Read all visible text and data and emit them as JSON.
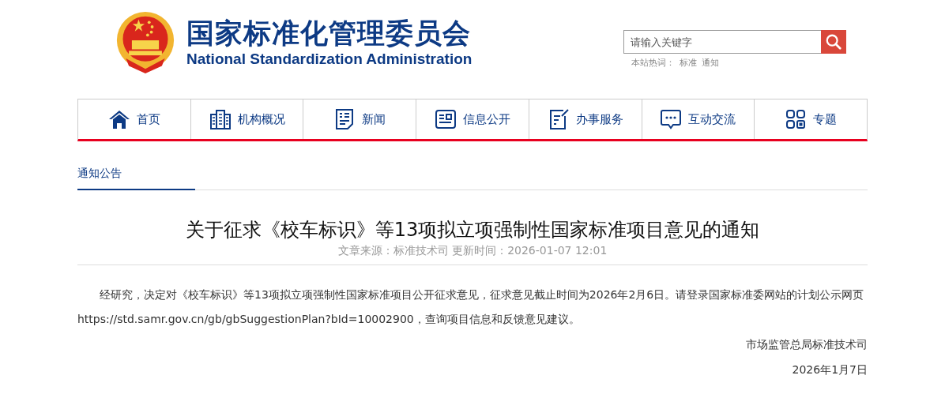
{
  "header": {
    "title": "国家标准化管理委员会",
    "subtitle": "National Standardization Administration"
  },
  "search": {
    "placeholder": "请输入关键字",
    "hot_label": "本站热词：",
    "hot_words": [
      "标准",
      "通知"
    ]
  },
  "nav": [
    {
      "label": "首页"
    },
    {
      "label": "机构概况"
    },
    {
      "label": "新闻"
    },
    {
      "label": "信息公开"
    },
    {
      "label": "办事服务"
    },
    {
      "label": "互动交流"
    },
    {
      "label": "专题"
    }
  ],
  "breadcrumb": "通知公告",
  "article": {
    "title": "关于征求《校车标识》等13项拟立项强制性国家标准项目意见的通知",
    "meta": "文章来源：标准技术司 更新时间：2026-01-07 12:01",
    "body": "经研究，决定对《校车标识》等13项拟立项强制性国家标准项目公开征求意见，征求意见截止时间为2026年2月6日。请登录国家标准委网站的计划公示网页https://std.samr.gov.cn/gb/gbSuggestionPlan?bId=10002900，查询项目信息和反馈意见建议。",
    "signature": "市场监管总局标准技术司",
    "date": "2026年1月7日"
  }
}
